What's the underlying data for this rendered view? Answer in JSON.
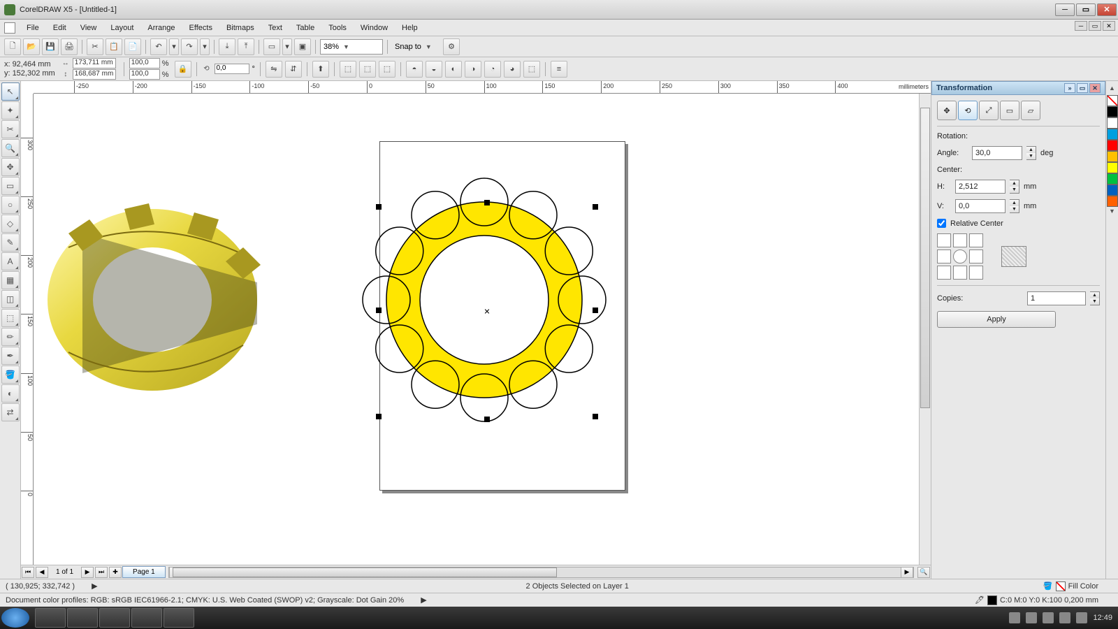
{
  "title": "CorelDRAW X5 - [Untitled-1]",
  "menu": [
    "File",
    "Edit",
    "View",
    "Layout",
    "Arrange",
    "Effects",
    "Bitmaps",
    "Text",
    "Table",
    "Tools",
    "Window",
    "Help"
  ],
  "toolbar1": {
    "zoom": "38%",
    "snap": "Snap to"
  },
  "propbar": {
    "x_label": "x:",
    "y_label": "y:",
    "x": "92,464 mm",
    "y": "152,302 mm",
    "w": "173,711 mm",
    "h": "168,687 mm",
    "scale_x": "100,0",
    "scale_y": "100,0",
    "pct": "%",
    "angle": "0,0",
    "deg": "°"
  },
  "ruler": {
    "h_ticks": [
      -250,
      -200,
      -150,
      -100,
      -50,
      0,
      50,
      100,
      150,
      200,
      250,
      300,
      350,
      400
    ],
    "v_ticks": [
      300,
      250,
      200,
      150,
      100,
      50,
      0
    ],
    "units": "millimeters"
  },
  "page_nav": {
    "counter": "1 of 1",
    "tab": "Page 1"
  },
  "status1": {
    "coords": "( 130,925; 332,742 )",
    "selection": "2 Objects Selected on Layer 1",
    "fill_label": "Fill Color"
  },
  "status2": {
    "profiles": "Document color profiles: RGB: sRGB IEC61966-2.1; CMYK: U.S. Web Coated (SWOP) v2; Grayscale: Dot Gain 20%",
    "outline": "C:0 M:0 Y:0 K:100  0,200 mm"
  },
  "docker": {
    "title": "Transformation",
    "rotation_label": "Rotation:",
    "angle_label": "Angle:",
    "angle_value": "30,0",
    "deg": "deg",
    "center_label": "Center:",
    "h_label": "H:",
    "h_value": "2,512",
    "v_label": "V:",
    "v_value": "0,0",
    "mm": "mm",
    "relative": "Relative Center",
    "copies_label": "Copies:",
    "copies_value": "1",
    "apply": "Apply"
  },
  "palette": [
    "#000000",
    "#ffffff",
    "#00a0e0",
    "#ff0000",
    "#ffc000",
    "#ffff00",
    "#00c040",
    "#0060c0",
    "#ff6000"
  ],
  "taskbar": {
    "clock": "12:49"
  },
  "toolbox_icons": [
    "↖",
    "✦",
    "✂",
    "🔍",
    "✥",
    "▭",
    "○",
    "◇",
    "✎",
    "A",
    "▦",
    "◫",
    "⬚",
    "✏",
    "✒",
    "🪣",
    "◐",
    "⇄"
  ],
  "std_icons": [
    "🗋",
    "📂",
    "💾",
    "🖨",
    "",
    "✂",
    "📋",
    "📄",
    "",
    "↶",
    "▾",
    "↷",
    "▾",
    "",
    "⤢",
    "⤡",
    "",
    "▭",
    "▾",
    "▣",
    "",
    "",
    "",
    "⚙"
  ],
  "prop_icons": [
    "⭯",
    "⇅",
    "⬚",
    "✦",
    "⬚",
    "⬚",
    "",
    "⬚",
    "⬚",
    "⬚",
    "⬚",
    "⬚",
    "⬚",
    "⬚",
    "",
    "≡"
  ]
}
